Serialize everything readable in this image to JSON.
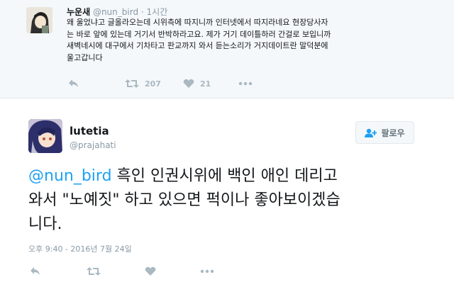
{
  "parent_tweet": {
    "name": "누운새",
    "handle": "@nun_bird",
    "separator": "·",
    "time": "1시간",
    "lines": [
      "왜 울었냐고 글올라오는데 시위측에 따지니까 인터넷에서 따지라네요 현장당사자",
      "는 바로 앞에 있는데 거기서 반박하라고요. 제가 거기 데이틀하러 간걸로 보입니까",
      "새벽네시에 대구에서 기차타고 판교까지 와서 듣는소리가 거지데이트란 말덕분에",
      "울고갑니다"
    ],
    "retweet_count": "207",
    "like_count": "21"
  },
  "main_tweet": {
    "name": "lutetia",
    "handle": "@prajahati",
    "follow_label": "팔로우",
    "mention": "@nun_bird",
    "line1_rest": " 흑인 인권시위에 백인 애인 데리고",
    "line2": "와서 \"노예짓\" 하고 있으면 퍽이나 좋아보이겠습",
    "line3": "니다.",
    "date": "오후 9:40 - 2016년 7월 24일"
  },
  "colors": {
    "accent": "#1da1f2",
    "muted": "#8899a6",
    "icon": "#aab8c2",
    "parent_bg": "#f5f8fa"
  }
}
